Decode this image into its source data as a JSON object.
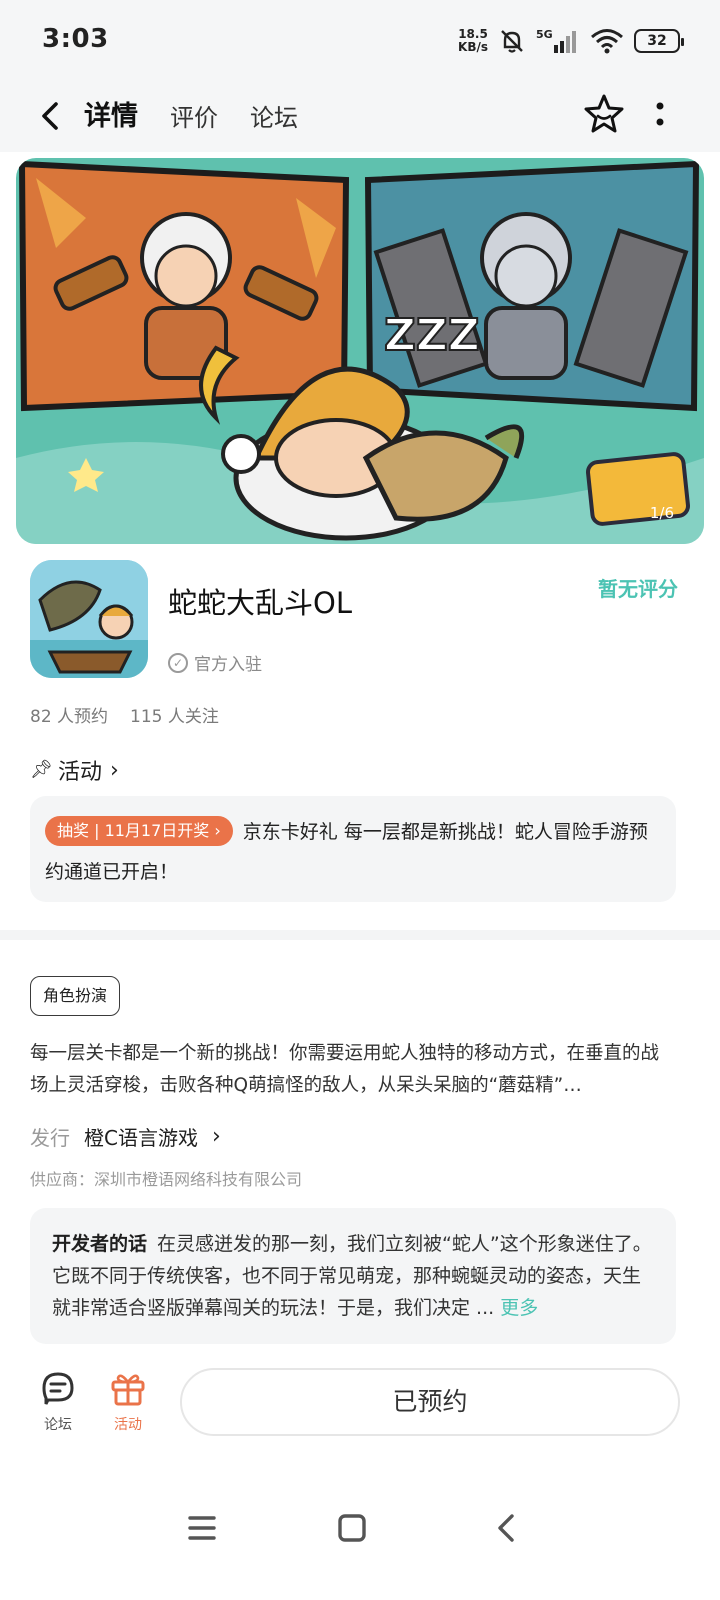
{
  "status_bar": {
    "time": "3:03",
    "net_speed_value": "18.5",
    "net_speed_unit": "KB/s",
    "battery": "32",
    "icons": [
      "mute-bell-icon",
      "5g-signal-icon",
      "wifi-icon",
      "battery-icon"
    ]
  },
  "top_nav": {
    "tabs": [
      {
        "label": "详情",
        "active": true
      },
      {
        "label": "评价",
        "active": false
      },
      {
        "label": "论坛",
        "active": false
      }
    ],
    "icons": [
      "back-arrow-icon",
      "favorite-star-icon",
      "more-vertical-icon"
    ]
  },
  "banner": {
    "page_indicator": "1/6",
    "zzz": "ZZZ"
  },
  "app": {
    "name": "蛇蛇大乱斗OL",
    "official": "官方入驻",
    "rating": "暂无评分",
    "reservations": "82 人预约",
    "followers": "115 人关注"
  },
  "activity": {
    "heading": "活动",
    "badge": "抽奖 | 11月17日开奖 ›",
    "text": "京东卡好礼 每一层都是新挑战！蛇人冒险手游预约通道已开启！"
  },
  "details": {
    "tag": "角色扮演",
    "description": "每一层关卡都是一个新的挑战！你需要运用蛇人独特的移动方式，在垂直的战场上灵活穿梭，击败各种Q萌搞怪的敌人，从呆头呆脑的“蘑菇精”…",
    "publisher_label": "发行",
    "publisher_name": "橙C语言游戏",
    "supplier": "供应商：深圳市橙语网络科技有限公司"
  },
  "developer": {
    "title": "开发者的话",
    "text": "在灵感迸发的那一刻，我们立刻被“蛇人”这个形象迷住了。它既不同于传统侠客，也不同于常见萌宠，那种蜿蜒灵动的姿态，天生就非常适合竖版弹幕闯关的玩法！于是，我们决定 ...",
    "more": "更多"
  },
  "bottom_bar": {
    "forum_label": "论坛",
    "activity_label": "活动",
    "reserved_button": "已预约"
  },
  "colors": {
    "accent": "#4cc3b3",
    "orange": "#ea7349",
    "banner_bg": "#5fc1ae"
  }
}
